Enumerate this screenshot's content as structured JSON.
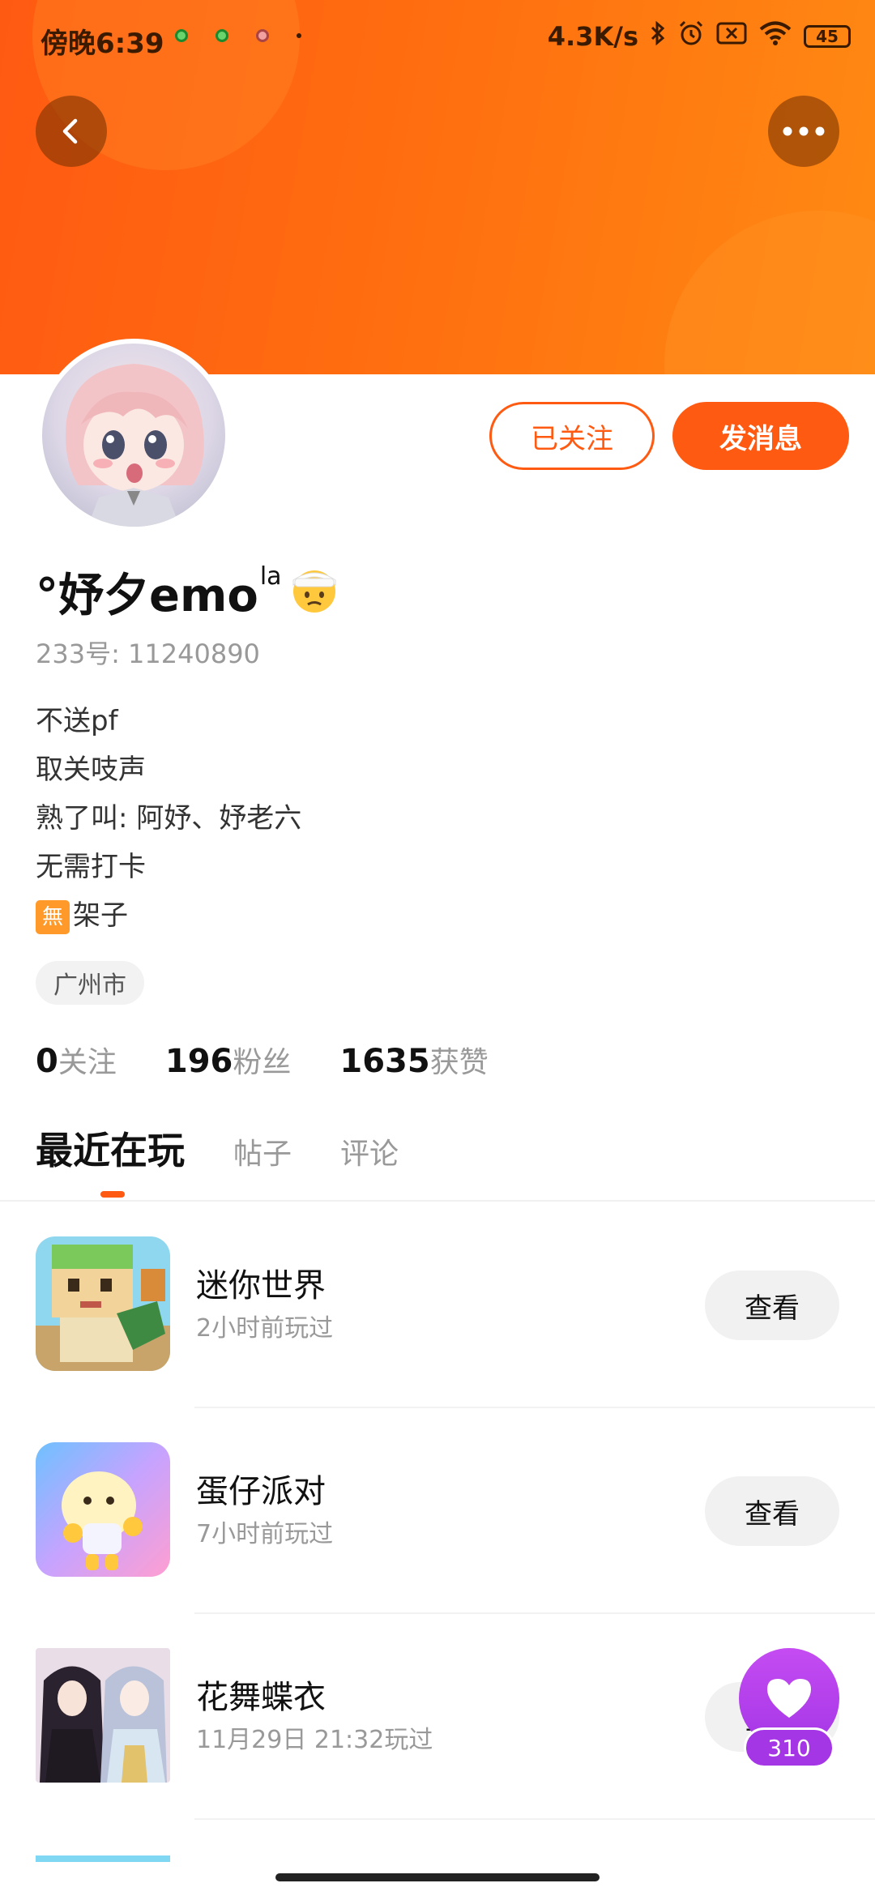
{
  "status_bar": {
    "time": "傍晚6:39",
    "network_speed": "4.3K/s",
    "battery": "45"
  },
  "header": {
    "follow_button_label": "已关注",
    "message_button_label": "发消息"
  },
  "profile": {
    "username": "°妤夕emo",
    "username_superscript": "la",
    "user_id_text": "233号: 11240890",
    "bio_lines": [
      "不送pf",
      "取关吱声",
      "熟了叫: 阿妤、妤老六",
      "无需打卡"
    ],
    "bio_last_line_badge": "無",
    "bio_last_line": "架子",
    "location": "广州市",
    "stats": [
      {
        "value": "0",
        "label": "关注"
      },
      {
        "value": "196",
        "label": "粉丝"
      },
      {
        "value": "1635",
        "label": "获赞"
      }
    ]
  },
  "tabs": [
    {
      "label": "最近在玩",
      "active": true
    },
    {
      "label": "帖子",
      "active": false
    },
    {
      "label": "评论",
      "active": false
    }
  ],
  "games": [
    {
      "name": "迷你世界",
      "played": "2小时前玩过",
      "button": "查看"
    },
    {
      "name": "蛋仔派对",
      "played": "7小时前玩过",
      "button": "查看"
    },
    {
      "name": "花舞蝶衣",
      "played": "11月29日 21:32玩过",
      "button": "查看"
    }
  ],
  "like_fab": {
    "count": "310"
  },
  "colors": {
    "accent": "#ff5a12",
    "like": "#a436e6"
  }
}
